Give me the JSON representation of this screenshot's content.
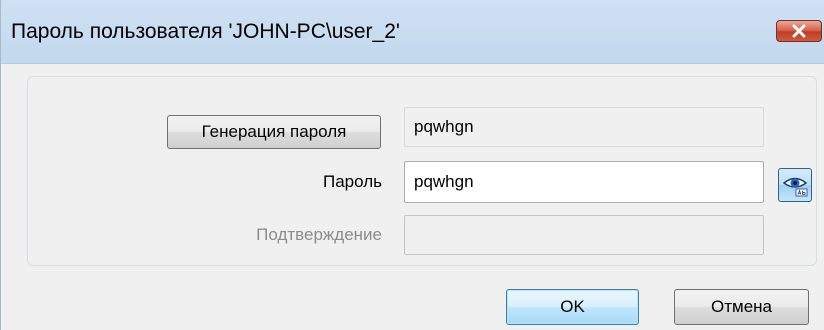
{
  "window": {
    "title": "Пароль пользователя 'JOHN-PC\\user_2'",
    "close_icon": "close-icon"
  },
  "form": {
    "generate_button_label": "Генерация пароля",
    "generated_value": "pqwhgn",
    "password_label": "Пароль",
    "password_value": "pqwhgn",
    "show_password_icon": "eye-icon",
    "confirm_label": "Подтверждение",
    "confirm_value": ""
  },
  "footer": {
    "ok_label": "OK",
    "cancel_label": "Отмена"
  },
  "colors": {
    "titlebar": "#c3d8ee",
    "close_button": "#c13d26",
    "dialog_background": "#f0f0f0",
    "default_button_border": "#3c7fb1"
  }
}
